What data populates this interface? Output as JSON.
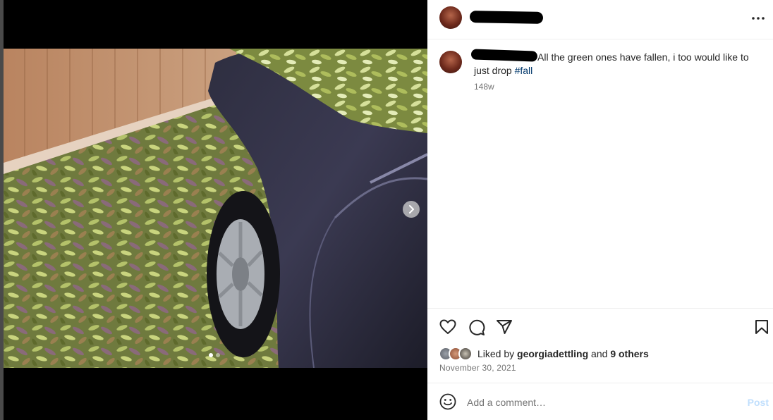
{
  "post": {
    "caption_text": "All the green ones have fallen, i too would like to just drop ",
    "caption_hashtag": "#fall",
    "time_ago": "148w",
    "likes_prefix": "Liked by ",
    "liked_by_user": "georgiadettling",
    "likes_and": " and ",
    "others_count": "9 others",
    "date": "November 30, 2021"
  },
  "comment": {
    "placeholder": "Add a comment…",
    "post_label": "Post"
  },
  "icons": {
    "more": "more-options-icon",
    "like": "heart-icon",
    "comment": "comment-icon",
    "share": "share-icon",
    "save": "bookmark-icon",
    "emoji": "emoji-icon",
    "next": "chevron-right-icon"
  },
  "carousel": {
    "slides": 2,
    "active": 1
  },
  "colors": {
    "hashtag": "#00376b",
    "post_button_disabled": "#c0dffd",
    "secondary_text": "#737373"
  }
}
